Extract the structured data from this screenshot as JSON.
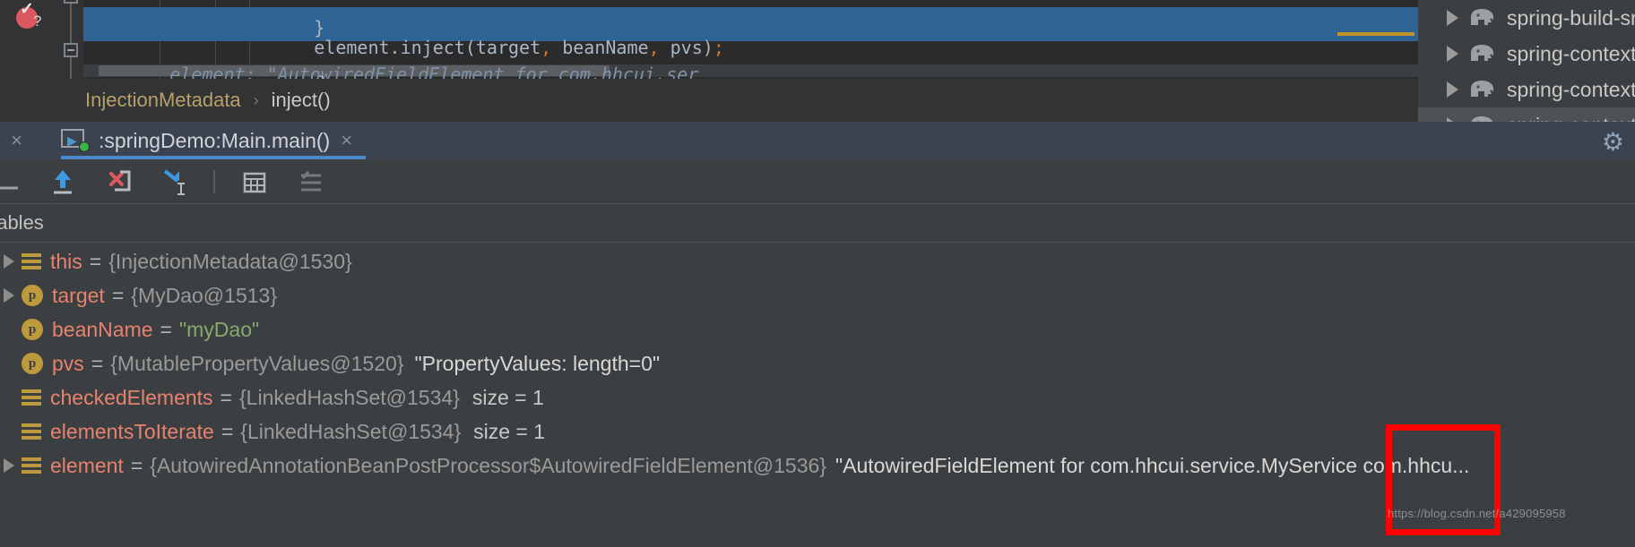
{
  "editor": {
    "code_prev": "}",
    "code_line": "element.inject(target, beanName, pvs);",
    "code_indent": "        ",
    "inline_hint": "element: \"AutowiredFieldElement for com.hhcui.ser",
    "code_next": "    }",
    "breakpoint_icon": "breakpoint-question-icon",
    "fold_icon": "code-fold-icon"
  },
  "breadcrumb": {
    "class_name": "InjectionMetadata",
    "separator": "›",
    "method_name": "inject()"
  },
  "gradle_panel": {
    "rows": [
      {
        "label": "spring-build-src",
        "icon": "gradle-elephant-icon",
        "arrow": "expand-arrow-icon",
        "selected": false
      },
      {
        "label": "spring-context",
        "icon": "gradle-elephant-icon",
        "arrow": "expand-arrow-icon",
        "selected": false
      },
      {
        "label": "spring-context-indexer",
        "icon": "gradle-elephant-icon",
        "arrow": "expand-arrow-icon",
        "selected": false
      },
      {
        "label": "spring-context-support",
        "icon": "gradle-elephant-icon",
        "arrow": "expand-arrow-icon",
        "selected": true
      }
    ]
  },
  "tabbar": {
    "ghost_tab_label": ")]",
    "ghost_close": "×",
    "active_tab_label": ":springDemo:Main.main()",
    "active_tab_close": "×",
    "active_tab_icon": "run-configuration-icon",
    "settings_icon": "gear-icon",
    "accent_color": "#4a88c7"
  },
  "toolbar": {
    "buttons": [
      {
        "name": "step-over-icon",
        "label": "Step Over"
      },
      {
        "name": "step-out-icon",
        "label": "Step Out"
      },
      {
        "name": "force-step-into-icon",
        "label": "Force Step Into"
      },
      {
        "name": "run-to-cursor-icon",
        "label": "Run to Cursor"
      },
      {
        "name": "evaluate-expression-icon",
        "label": "Evaluate Expression"
      },
      {
        "name": "settings-list-icon",
        "label": "Layout Settings"
      }
    ]
  },
  "variables_panel": {
    "title": "riables",
    "rows": [
      {
        "icon": "field-icon",
        "expandable": true,
        "name": "this",
        "type": "{InjectionMetadata@1530}",
        "string_value": "",
        "extra": ""
      },
      {
        "icon": "param-icon",
        "expandable": true,
        "name": "target",
        "type": "{MyDao@1513}",
        "string_value": "",
        "extra": ""
      },
      {
        "icon": "param-icon",
        "expandable": false,
        "name": "beanName",
        "type": "",
        "string_value": "\"myDao\"",
        "extra": ""
      },
      {
        "icon": "param-icon",
        "expandable": false,
        "name": "pvs",
        "type": "{MutablePropertyValues@1520}",
        "string_value": "",
        "extra": "\"PropertyValues: length=0\""
      },
      {
        "icon": "field-icon",
        "expandable": false,
        "name": "checkedElements",
        "type": "{LinkedHashSet@1534}",
        "string_value": "",
        "extra": "size = 1"
      },
      {
        "icon": "field-icon",
        "expandable": false,
        "name": "elementsToIterate",
        "type": "{LinkedHashSet@1534}",
        "string_value": "",
        "extra": "size = 1"
      },
      {
        "icon": "field-icon",
        "expandable": true,
        "name": "element",
        "type": "{AutowiredAnnotationBeanPostProcessor$AutowiredFieldElement@1536}",
        "string_value": "",
        "extra": "\"AutowiredFieldElement for com.hhcui.service.MyService com.hhcu..."
      }
    ]
  },
  "annotation": {
    "highlight_color": "#fe0000",
    "watermark": "https://blog.csdn.net/a429095958"
  }
}
